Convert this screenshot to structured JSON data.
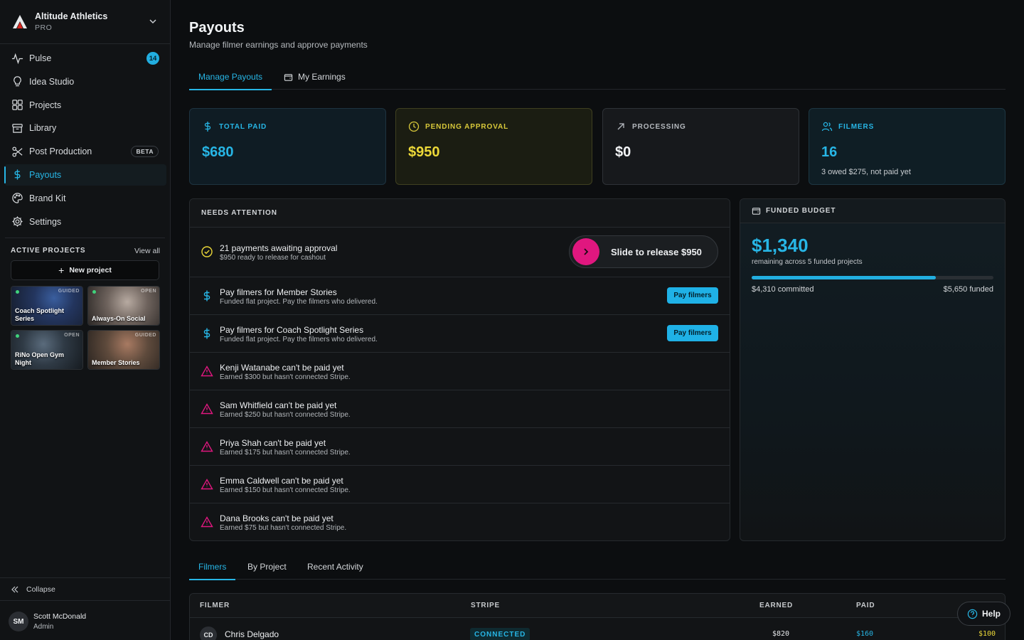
{
  "org": {
    "name": "Altitude Athletics",
    "plan": "PRO"
  },
  "nav": {
    "items": [
      {
        "label": "Pulse",
        "badge": "14"
      },
      {
        "label": "Idea Studio"
      },
      {
        "label": "Projects"
      },
      {
        "label": "Library"
      },
      {
        "label": "Post Production",
        "tag": "BETA"
      },
      {
        "label": "Payouts",
        "active": true
      },
      {
        "label": "Brand Kit"
      },
      {
        "label": "Settings"
      }
    ]
  },
  "active_projects": {
    "title": "ACTIVE PROJECTS",
    "view_all": "View all",
    "new_project": "New project",
    "projects": [
      {
        "name": "Coach Spotlight Series",
        "status": "GUIDED"
      },
      {
        "name": "Always-On Social",
        "status": "OPEN"
      },
      {
        "name": "RiNo Open Gym Night",
        "status": "OPEN"
      },
      {
        "name": "Member Stories",
        "status": "GUIDED"
      }
    ]
  },
  "sidebar_footer": {
    "collapse": "Collapse"
  },
  "user": {
    "initials": "SM",
    "name": "Scott McDonald",
    "role": "Admin"
  },
  "page": {
    "title": "Payouts",
    "subtitle": "Manage filmer earnings and approve payments"
  },
  "tabs": [
    {
      "label": "Manage Payouts"
    },
    {
      "label": "My Earnings"
    }
  ],
  "stats": [
    {
      "label": "TOTAL PAID",
      "value": "$680",
      "note": ""
    },
    {
      "label": "PENDING APPROVAL",
      "value": "$950",
      "note": ""
    },
    {
      "label": "PROCESSING",
      "value": "$0",
      "note": ""
    },
    {
      "label": "FILMERS",
      "value": "16",
      "note": "3 owed $275, not paid yet"
    }
  ],
  "needs_attention": {
    "title": "NEEDS ATTENTION",
    "approval": {
      "title": "21 payments awaiting approval",
      "subtitle": "$950 ready to release for cashout",
      "slider": "Slide to release $950"
    },
    "pay_rows": [
      {
        "title": "Pay filmers for Member Stories",
        "subtitle": "Funded flat project. Pay the filmers who delivered.",
        "button": "Pay filmers"
      },
      {
        "title": "Pay filmers for Coach Spotlight Series",
        "subtitle": "Funded flat project. Pay the filmers who delivered.",
        "button": "Pay filmers"
      }
    ],
    "warnings": [
      {
        "title": "Kenji Watanabe can't be paid yet",
        "subtitle": "Earned $300 but hasn't connected Stripe."
      },
      {
        "title": "Sam Whitfield can't be paid yet",
        "subtitle": "Earned $250 but hasn't connected Stripe."
      },
      {
        "title": "Priya Shah can't be paid yet",
        "subtitle": "Earned $175 but hasn't connected Stripe."
      },
      {
        "title": "Emma Caldwell can't be paid yet",
        "subtitle": "Earned $150 but hasn't connected Stripe."
      },
      {
        "title": "Dana Brooks can't be paid yet",
        "subtitle": "Earned $75 but hasn't connected Stripe."
      }
    ]
  },
  "budget": {
    "title": "FUNDED BUDGET",
    "value": "$1,340",
    "subtitle": "remaining across 5 funded projects",
    "committed": "$4,310 committed",
    "funded": "$5,650 funded",
    "progress": 0.763
  },
  "bottom_tabs": [
    {
      "label": "Filmers"
    },
    {
      "label": "By Project"
    },
    {
      "label": "Recent Activity"
    }
  ],
  "table": {
    "headers": [
      "FILMER",
      "STRIPE",
      "EARNED",
      "PAID"
    ],
    "rows": [
      {
        "initials": "CD",
        "name": "Chris Delgado",
        "stripe": "CONNECTED",
        "earned": "$820",
        "paid": "$160",
        "owed": "$100"
      }
    ]
  },
  "help": {
    "label": "Help"
  },
  "colors": {
    "accent": "#27b6e6",
    "pink": "#e0177f",
    "yellow": "#ecd838"
  }
}
